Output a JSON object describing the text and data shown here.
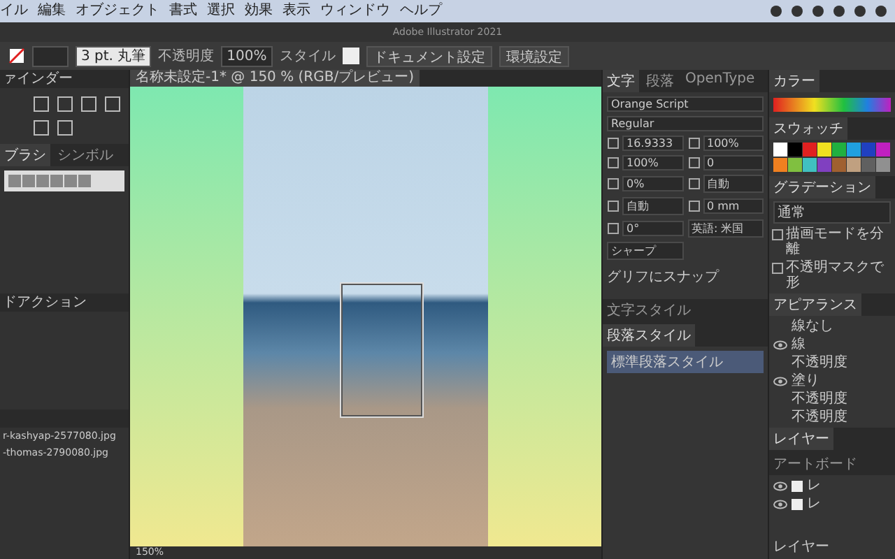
{
  "menu_bar": {
    "items": [
      "イル",
      "編集",
      "オブジェクト",
      "書式",
      "選択",
      "効果",
      "表示",
      "ウィンドウ",
      "ヘルプ"
    ]
  },
  "app_title": "Adobe Illustrator 2021",
  "control_bar": {
    "brush": "3 pt. 丸筆",
    "opacity_label": "不透明度",
    "opacity": "100%",
    "style_label": "スタイル",
    "buttons": [
      "ドキュメント設定",
      "環境設定"
    ]
  },
  "left_panel": {
    "top_title": "ァインダー",
    "library_tabs": [
      {
        "label": "ブラシ",
        "selected": true
      },
      {
        "label": "シンボル",
        "selected": false
      }
    ],
    "actions_title": "ドアクション",
    "files": [
      "r-kashyap-2577080.jpg",
      "-thomas-2790080.jpg"
    ]
  },
  "document_tab": {
    "title": "名称未設定-1* @ 150 % (RGB/プレビュー)"
  },
  "status_bar": {
    "zoom": "150%"
  },
  "character_panel": {
    "tabs": [
      {
        "label": "文字",
        "selected": true
      },
      {
        "label": "段落",
        "selected": false
      },
      {
        "label": "OpenType",
        "selected": false
      }
    ],
    "font": "Orange Script",
    "style": "Regular",
    "fields": [
      "16.9333",
      "100%",
      "100%",
      "0",
      "0%",
      "自動",
      "自動",
      "0 mm",
      "0°"
    ],
    "language": "英語: 米国",
    "antialias": "シャープ",
    "snap_label": "グリフにスナップ",
    "style_tabs": [
      {
        "label": "文字スタイル",
        "selected": false
      },
      {
        "label": "段落スタイル",
        "selected": true
      }
    ],
    "styles": [
      {
        "label": "標準段落スタイル",
        "selected": true
      }
    ]
  },
  "side_panels": {
    "color_tab": "カラー",
    "swatches_tab": "スウォッチ",
    "gradient_tab": "グラデーション",
    "blend_mode": "通常",
    "options": [
      {
        "label": "描画モードを分離",
        "checked": false
      },
      {
        "label": "不透明マスクで形",
        "checked": false
      }
    ],
    "appearance_tab": "アピアランス",
    "appearance_rows": [
      {
        "label": "線なし",
        "visible": false
      },
      {
        "label": "線",
        "visible": true
      },
      {
        "label": "不透明度",
        "visible": false
      },
      {
        "label": "塗り",
        "visible": true
      },
      {
        "label": "不透明度",
        "visible": false
      },
      {
        "label": "不透明度",
        "visible": false
      }
    ],
    "layer_tabs": [
      {
        "label": "レイヤー",
        "selected": true
      },
      {
        "label": "アートボード",
        "selected": false
      }
    ],
    "layers": [
      {
        "name": "レ",
        "visible": true
      },
      {
        "name": "レ",
        "visible": true
      }
    ],
    "layer_count": "レイヤー"
  }
}
